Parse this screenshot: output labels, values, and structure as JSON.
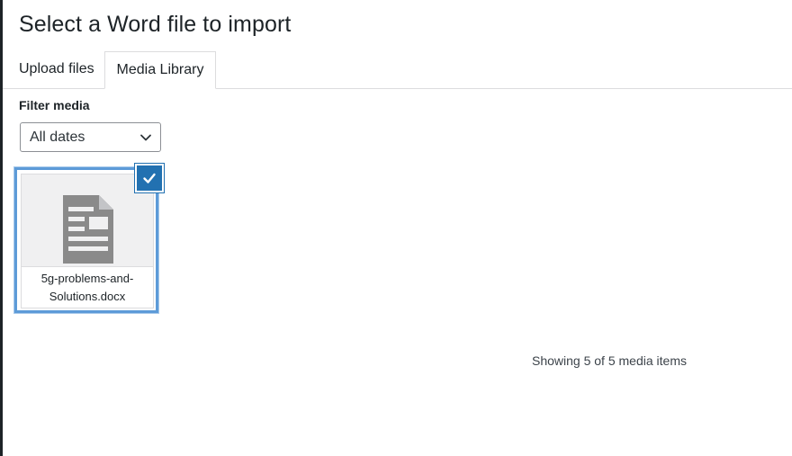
{
  "modal": {
    "title": "Select a Word file to import"
  },
  "tabs": [
    {
      "label": "Upload files",
      "active": false
    },
    {
      "label": "Media Library",
      "active": true
    }
  ],
  "filter": {
    "label": "Filter media",
    "selected": "All dates"
  },
  "attachments": [
    {
      "icon": "document-icon",
      "filename_line1": "5g-problems-and-",
      "filename_line2": "Solutions.docx",
      "selected": true
    }
  ],
  "status": {
    "text": "Showing 5 of 5 media items"
  },
  "colors": {
    "accent": "#2271b1",
    "selection_border": "#5d9bd8",
    "icon_gray": "#8a8a8a",
    "text": "#1d2327"
  }
}
